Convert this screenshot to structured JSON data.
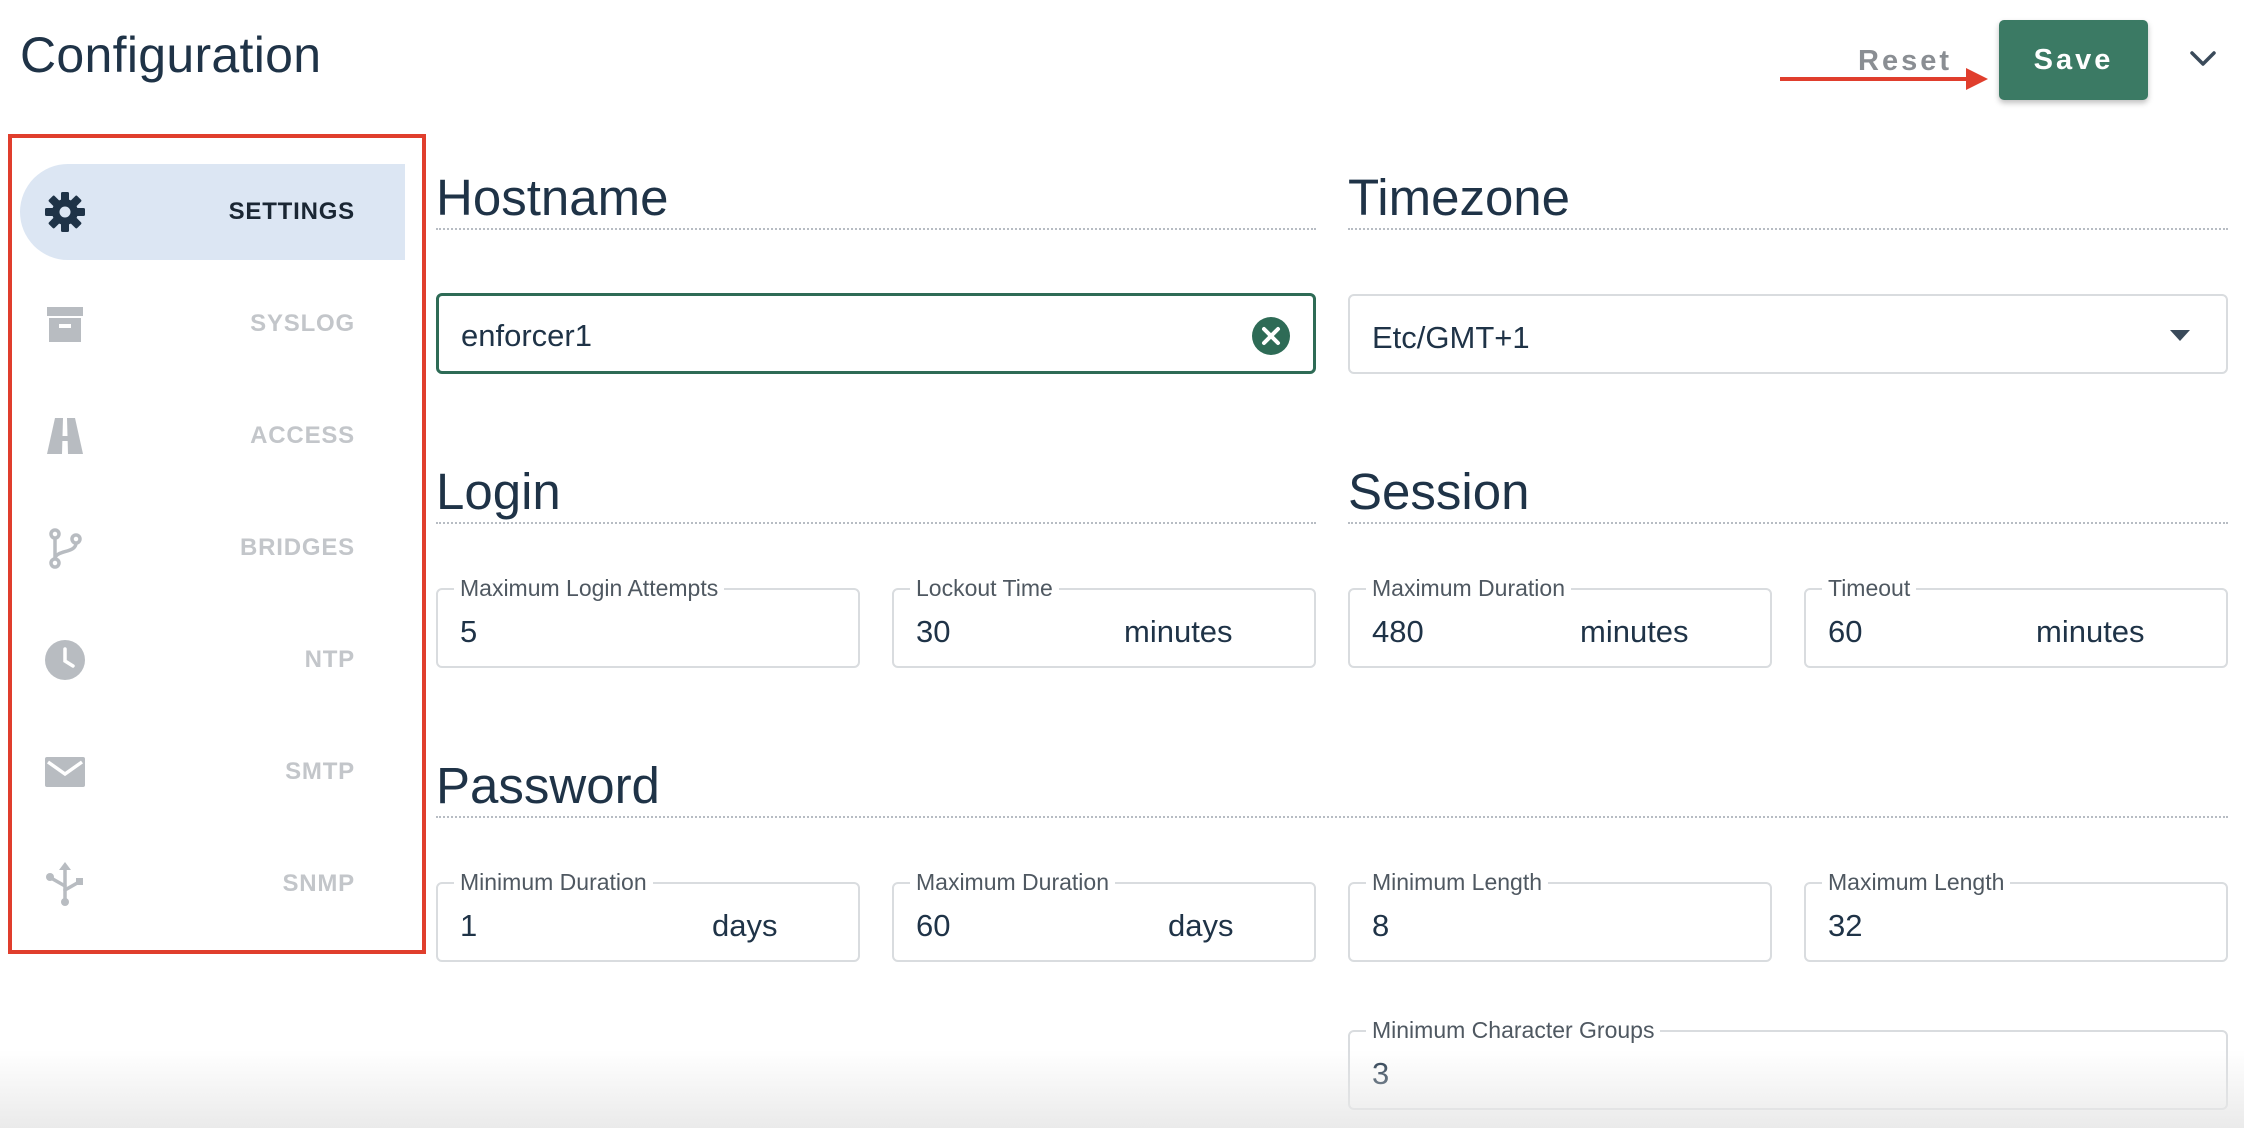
{
  "page": {
    "title": "Configuration"
  },
  "toolbar": {
    "reset_label": "Reset",
    "save_label": "Save"
  },
  "colors": {
    "accent": "#3b7a64",
    "annotation": "#e03e2d",
    "sidebar_active_bg": "#dce6f3"
  },
  "sidebar": {
    "items": [
      {
        "label": "SETTINGS",
        "icon": "gear-icon",
        "active": true
      },
      {
        "label": "SYSLOG",
        "icon": "archive-icon",
        "active": false
      },
      {
        "label": "ACCESS",
        "icon": "road-icon",
        "active": false
      },
      {
        "label": "BRIDGES",
        "icon": "branch-icon",
        "active": false
      },
      {
        "label": "NTP",
        "icon": "clock-icon",
        "active": false
      },
      {
        "label": "SMTP",
        "icon": "envelope-icon",
        "active": false
      },
      {
        "label": "SNMP",
        "icon": "network-icon",
        "active": false
      }
    ]
  },
  "hostname": {
    "title": "Hostname",
    "value": "enforcer1"
  },
  "timezone": {
    "title": "Timezone",
    "value": "Etc/GMT+1"
  },
  "login": {
    "title": "Login",
    "max_attempts": {
      "label": "Maximum Login Attempts",
      "value": "5"
    },
    "lockout_time": {
      "label": "Lockout Time",
      "value": "30",
      "unit": "minutes"
    }
  },
  "session": {
    "title": "Session",
    "max_duration": {
      "label": "Maximum Duration",
      "value": "480",
      "unit": "minutes"
    },
    "timeout": {
      "label": "Timeout",
      "value": "60",
      "unit": "minutes"
    }
  },
  "password": {
    "title": "Password",
    "min_duration": {
      "label": "Minimum Duration",
      "value": "1",
      "unit": "days"
    },
    "max_duration": {
      "label": "Maximum Duration",
      "value": "60",
      "unit": "days"
    },
    "min_length": {
      "label": "Minimum Length",
      "value": "8"
    },
    "max_length": {
      "label": "Maximum Length",
      "value": "32"
    },
    "min_char_groups": {
      "label": "Minimum Character Groups",
      "value": "3"
    }
  }
}
